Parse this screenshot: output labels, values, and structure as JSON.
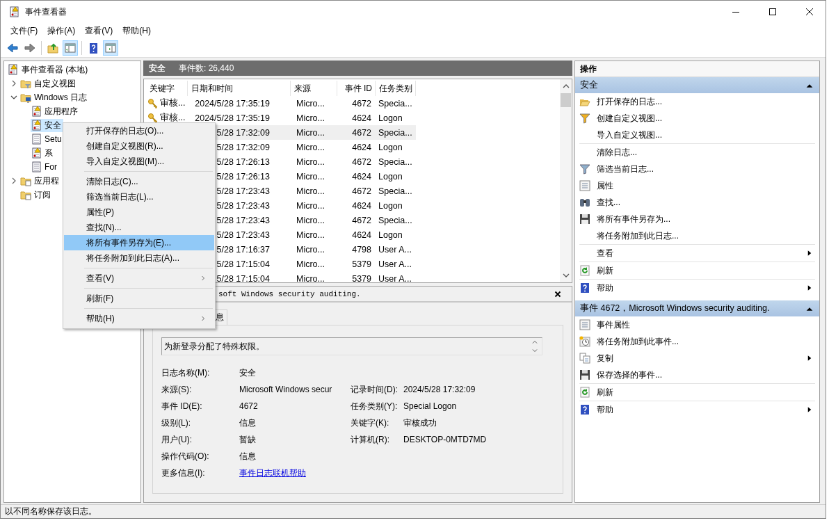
{
  "window": {
    "title": "事件查看器"
  },
  "menu": [
    "文件(F)",
    "操作(A)",
    "查看(V)",
    "帮助(H)"
  ],
  "toolbar": [
    {
      "pressed": false
    },
    {
      "pressed": false
    },
    {
      "pressed": false
    },
    {
      "pressed": true
    },
    {
      "pressed": false
    },
    {
      "pressed": true
    }
  ],
  "tree": [
    {
      "label": "事件查看器 (本地)",
      "selected": false,
      "children": [
        {
          "label": "自定义视图",
          "expanded": false,
          "selected": false
        },
        {
          "label": "Windows 日志",
          "expanded": true,
          "selected": false,
          "children": [
            {
              "label": "应用程序",
              "selected": false
            },
            {
              "label": "安全",
              "selected": true
            },
            {
              "label": "Setu",
              "selected": false
            },
            {
              "label": "系",
              "selected": false
            },
            {
              "label": "For",
              "selected": false
            }
          ]
        },
        {
          "label": "应用程",
          "expanded": false,
          "selected": false
        },
        {
          "label": "订阅",
          "selected": false
        }
      ]
    }
  ],
  "log_header": {
    "name": "安全",
    "count": "事件数: 26,440"
  },
  "table": {
    "columns": [
      "关键字",
      "日期和时间",
      "来源",
      "事件 ID",
      "任务类别"
    ],
    "rows": [
      {
        "keyword": "审核...",
        "date": "2024/5/28 17:35:19",
        "source": "Micro...",
        "id": "4672",
        "category": "Specia...",
        "selected": false
      },
      {
        "keyword": "审核...",
        "date": "2024/5/28 17:35:19",
        "source": "Micro...",
        "id": "4624",
        "category": "Logon",
        "selected": false
      },
      {
        "date": "5/28 17:32:09",
        "source": "Micro...",
        "id": "4672",
        "category": "Specia...",
        "selected": true
      },
      {
        "date": "5/28 17:32:09",
        "source": "Micro...",
        "id": "4624",
        "category": "Logon",
        "selected": false
      },
      {
        "date": "5/28 17:26:13",
        "source": "Micro...",
        "id": "4672",
        "category": "Specia...",
        "selected": false
      },
      {
        "date": "5/28 17:26:13",
        "source": "Micro...",
        "id": "4624",
        "category": "Logon",
        "selected": false
      },
      {
        "date": "5/28 17:23:43",
        "source": "Micro...",
        "id": "4672",
        "category": "Specia...",
        "selected": false
      },
      {
        "date": "5/28 17:23:43",
        "source": "Micro...",
        "id": "4624",
        "category": "Logon",
        "selected": false
      },
      {
        "date": "5/28 17:23:43",
        "source": "Micro...",
        "id": "4672",
        "category": "Specia...",
        "selected": false
      },
      {
        "date": "5/28 17:23:43",
        "source": "Micro...",
        "id": "4624",
        "category": "Logon",
        "selected": false
      },
      {
        "date": "5/28 17:16:37",
        "source": "Micro...",
        "id": "4798",
        "category": "User A...",
        "selected": false
      },
      {
        "date": "5/28 17:15:04",
        "source": "Micro...",
        "id": "5379",
        "category": "User A...",
        "selected": false
      },
      {
        "date": "5/28 17:15:04",
        "source": "Micro...",
        "id": "5379",
        "category": "User A...",
        "selected": false
      }
    ]
  },
  "detail": {
    "title": "soft Windows security auditing.",
    "tabs": [
      {
        "label": "息",
        "selected": false
      }
    ],
    "description": "为新登录分配了特殊权限。",
    "fields": [
      [
        {
          "label": "日志名称(M):",
          "value": "安全"
        }
      ],
      [
        {
          "label": "来源(S):",
          "value": "Microsoft Windows secur"
        },
        {
          "label": "记录时间(D):",
          "value": "2024/5/28 17:32:09"
        }
      ],
      [
        {
          "label": "事件 ID(E):",
          "value": "4672"
        },
        {
          "label": "任务类别(Y):",
          "value": "Special Logon"
        }
      ],
      [
        {
          "label": "级别(L):",
          "value": "信息"
        },
        {
          "label": "关键字(K):",
          "value": "审核成功"
        }
      ],
      [
        {
          "label": "用户(U):",
          "value": "暂缺"
        },
        {
          "label": "计算机(R):",
          "value": "DESKTOP-0MTD7MD"
        }
      ],
      [
        {
          "label": "操作代码(O):",
          "value": "信息"
        }
      ]
    ],
    "more_info": {
      "label": "更多信息(I):",
      "link": "事件日志联机帮助"
    }
  },
  "context_menu": [
    {
      "kind": "item",
      "label": "打开保存的日志(O)...",
      "selected": false
    },
    {
      "kind": "item",
      "label": "创建自定义视图(R)...",
      "selected": false
    },
    {
      "kind": "item",
      "label": "导入自定义视图(M)...",
      "selected": false
    },
    {
      "kind": "separator"
    },
    {
      "kind": "item",
      "label": "清除日志(C)...",
      "selected": false
    },
    {
      "kind": "item",
      "label": "筛选当前日志(L)...",
      "selected": false
    },
    {
      "kind": "item",
      "label": "属性(P)",
      "selected": false
    },
    {
      "kind": "item",
      "label": "查找(N)...",
      "selected": false
    },
    {
      "kind": "item",
      "label": "将所有事件另存为(E)...",
      "selected": true
    },
    {
      "kind": "item",
      "label": "将任务附加到此日志(A)...",
      "selected": false
    },
    {
      "kind": "separator"
    },
    {
      "kind": "submenu",
      "label": "查看(V)",
      "selected": false
    },
    {
      "kind": "separator"
    },
    {
      "kind": "item",
      "label": "刷新(F)",
      "selected": false
    },
    {
      "kind": "separator"
    },
    {
      "kind": "submenu",
      "label": "帮助(H)",
      "selected": false
    }
  ],
  "actions": {
    "title": "操作",
    "sections": [
      {
        "title": "安全",
        "expanded": true,
        "items": [
          {
            "kind": "item",
            "label": "打开保存的日志..."
          },
          {
            "kind": "item",
            "label": "创建自定义视图..."
          },
          {
            "kind": "item",
            "label": "导入自定义视图..."
          },
          {
            "kind": "separator"
          },
          {
            "kind": "item",
            "label": "清除日志..."
          },
          {
            "kind": "item",
            "label": "筛选当前日志..."
          },
          {
            "kind": "item",
            "label": "属性"
          },
          {
            "kind": "item",
            "label": "查找..."
          },
          {
            "kind": "item",
            "label": "将所有事件另存为..."
          },
          {
            "kind": "item",
            "label": "将任务附加到此日志..."
          },
          {
            "kind": "separator"
          },
          {
            "kind": "submenu",
            "label": "查看"
          },
          {
            "kind": "separator"
          },
          {
            "kind": "item",
            "label": "刷新"
          },
          {
            "kind": "separator"
          },
          {
            "kind": "submenu",
            "label": "帮助"
          }
        ]
      },
      {
        "title": "事件 4672，Microsoft Windows security auditing.",
        "expanded": true,
        "items": [
          {
            "kind": "item",
            "label": "事件属性"
          },
          {
            "kind": "item",
            "label": "将任务附加到此事件..."
          },
          {
            "kind": "submenu",
            "label": "复制"
          },
          {
            "kind": "item",
            "label": "保存选择的事件..."
          },
          {
            "kind": "separator"
          },
          {
            "kind": "item",
            "label": "刷新"
          },
          {
            "kind": "separator"
          },
          {
            "kind": "submenu",
            "label": "帮助"
          }
        ]
      }
    ]
  },
  "status_bar": "以不同名称保存该日志。"
}
